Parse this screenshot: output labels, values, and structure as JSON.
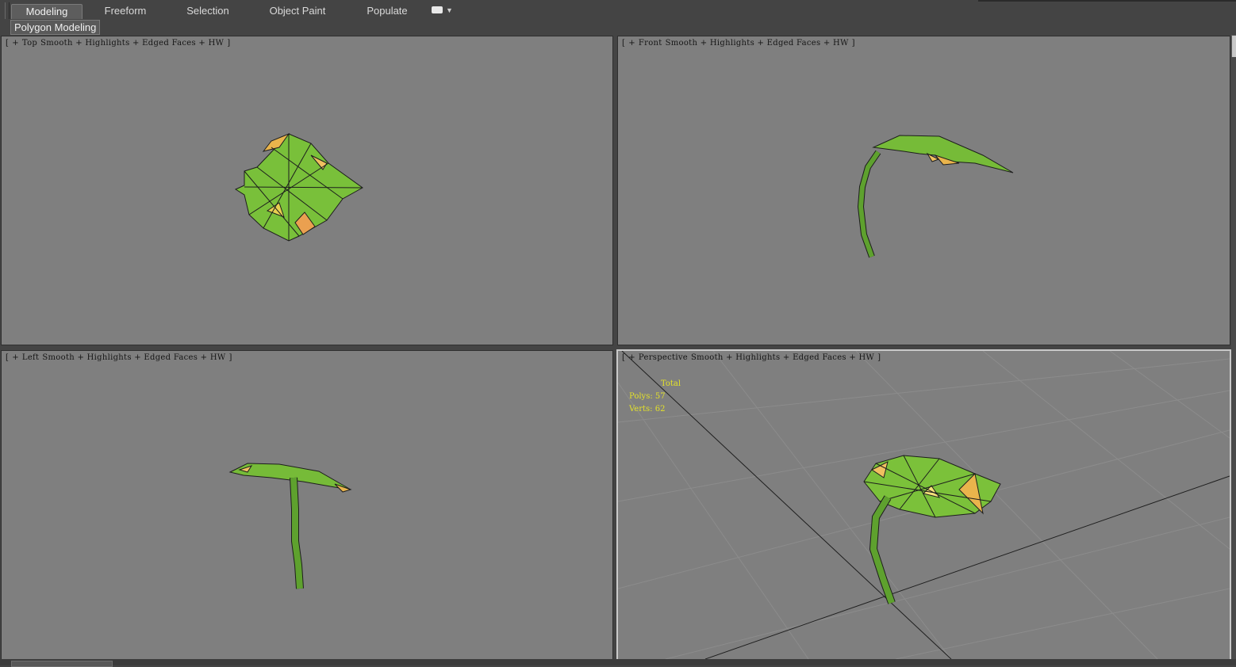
{
  "ribbon": {
    "tabs": [
      {
        "label": "Modeling",
        "active": true
      },
      {
        "label": "Freeform",
        "active": false
      },
      {
        "label": "Selection",
        "active": false
      },
      {
        "label": "Object Paint",
        "active": false
      },
      {
        "label": "Populate",
        "active": false
      }
    ],
    "panel_label": "Polygon Modeling"
  },
  "viewports": {
    "top": {
      "bracket_open": "[",
      "plus": "+",
      "view": "Top",
      "shading": "Smooth + Highlights + Edged Faces + HW",
      "bracket_close": "]"
    },
    "front": {
      "bracket_open": "[",
      "plus": "+",
      "view": "Front",
      "shading": "Smooth + Highlights + Edged Faces + HW",
      "bracket_close": "]"
    },
    "left": {
      "bracket_open": "[",
      "plus": "+",
      "view": "Left",
      "shading": "Smooth + Highlights + Edged Faces + HW",
      "bracket_close": "]"
    },
    "perspective": {
      "bracket_open": "[",
      "plus": "+",
      "view": "Perspective",
      "shading": "Smooth + Highlights + Edged Faces + HW",
      "bracket_close": "]",
      "stats": {
        "total_label": "Total",
        "polys": "Polys: 57",
        "verts": "Verts: 62"
      }
    }
  },
  "colors": {
    "viewport_bg": "#7f7f7f",
    "leaf_green": "#7cc23a",
    "leaf_highlight": "#e9b44c",
    "stats_yellow": "#e3e12a"
  }
}
